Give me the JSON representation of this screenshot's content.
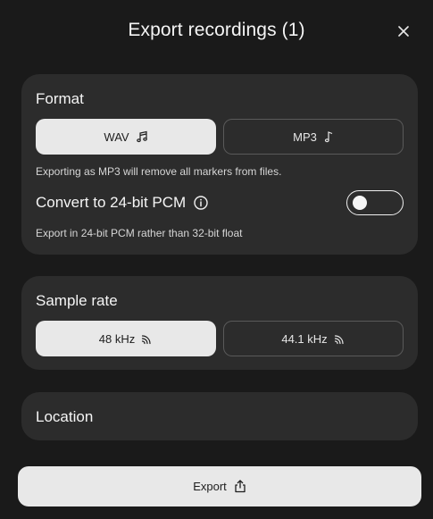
{
  "header": {
    "title": "Export recordings (1)"
  },
  "format": {
    "title": "Format",
    "options": [
      {
        "label": "WAV",
        "icon": "music-notes-icon",
        "selected": true
      },
      {
        "label": "MP3",
        "icon": "music-note-icon",
        "selected": false
      }
    ],
    "note": "Exporting as MP3 will remove all markers from files.",
    "pcm_label": "Convert to 24-bit PCM",
    "pcm_enabled": false,
    "pcm_note": "Export in 24-bit PCM rather than 32-bit float"
  },
  "sample_rate": {
    "title": "Sample rate",
    "options": [
      {
        "label": "48 kHz",
        "icon": "signal-icon",
        "selected": true
      },
      {
        "label": "44.1 kHz",
        "icon": "signal-icon",
        "selected": false
      }
    ]
  },
  "location": {
    "title": "Location"
  },
  "footer": {
    "export_label": "Export",
    "export_icon": "share-icon"
  },
  "colors": {
    "background": "#1a1a1a",
    "card": "#2c2c2c",
    "selected": "#e8e8e8",
    "text": "#f5f5f5"
  }
}
